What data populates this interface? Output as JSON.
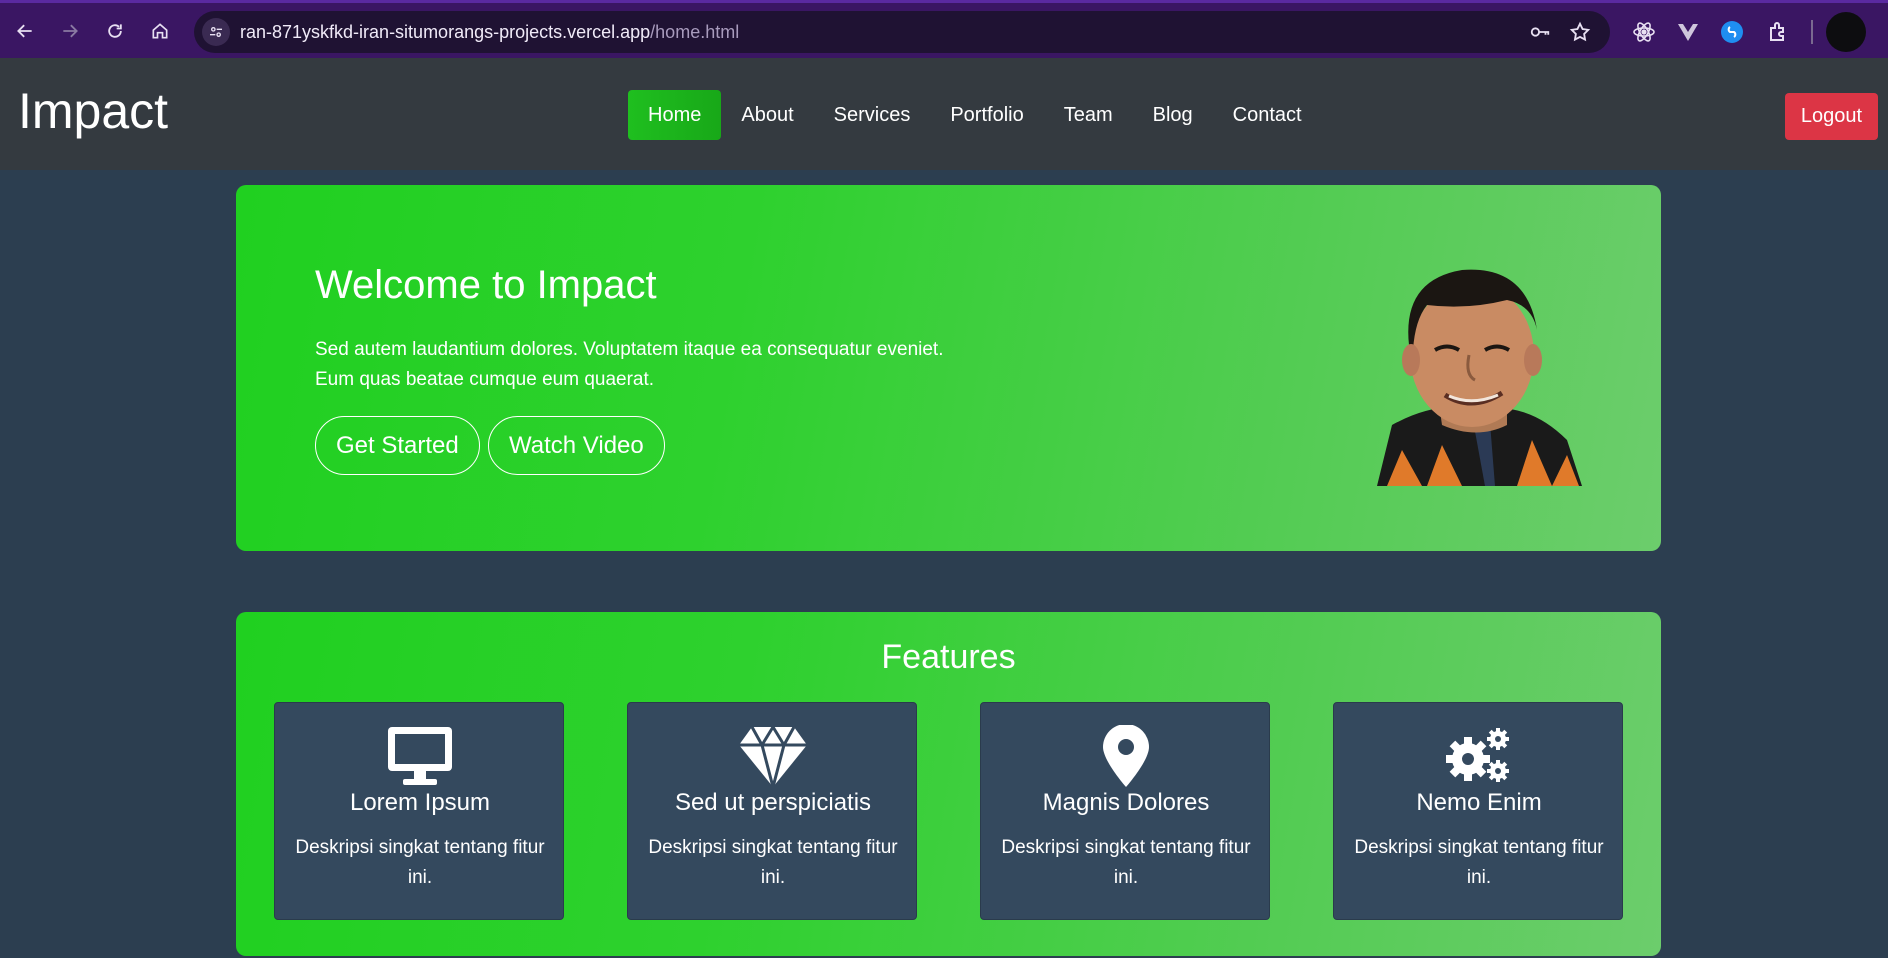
{
  "browser": {
    "url_host": "ran-871yskfkd-iran-situmorangs-projects.vercel.app",
    "url_path": "/home.html"
  },
  "site": {
    "logo": "Impact",
    "menu": [
      {
        "label": "Home",
        "active": true
      },
      {
        "label": "About"
      },
      {
        "label": "Services"
      },
      {
        "label": "Portfolio"
      },
      {
        "label": "Team"
      },
      {
        "label": "Blog"
      },
      {
        "label": "Contact"
      }
    ],
    "logout_label": "Logout"
  },
  "hero": {
    "title": "Welcome to Impact",
    "text": "Sed autem laudantium dolores. Voluptatem itaque ea consequatur eveniet. Eum quas beatae cumque eum quaerat.",
    "primary_button": "Get Started",
    "secondary_button": "Watch Video"
  },
  "features": {
    "title": "Features",
    "items": [
      {
        "icon": "desktop-icon",
        "title": "Lorem Ipsum",
        "text": "Deskripsi singkat tentang fitur ini."
      },
      {
        "icon": "diamond-icon",
        "title": "Sed ut perspiciatis",
        "text": "Deskripsi singkat tentang fitur ini."
      },
      {
        "icon": "map-pin-icon",
        "title": "Magnis Dolores",
        "text": "Deskripsi singkat tentang fitur ini."
      },
      {
        "icon": "gears-icon",
        "title": "Nemo Enim",
        "text": "Deskripsi singkat tentang fitur ini."
      }
    ]
  },
  "colors": {
    "accent_green": "#20d020",
    "page_bg": "#2c3e50",
    "header_bg": "#343a40",
    "logout_red": "#dc3545",
    "card_bg": "#34495e",
    "browser_frame": "#3a1663"
  }
}
